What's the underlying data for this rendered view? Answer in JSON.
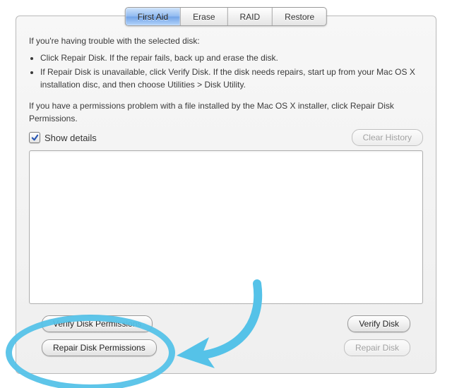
{
  "tabs": {
    "items": [
      {
        "label": "First Aid",
        "selected": true
      },
      {
        "label": "Erase",
        "selected": false
      },
      {
        "label": "RAID",
        "selected": false
      },
      {
        "label": "Restore",
        "selected": false
      }
    ]
  },
  "intro": {
    "line1": "If you're having trouble with the selected disk:",
    "bullet1": "Click Repair Disk. If the repair fails, back up and erase the disk.",
    "bullet2": "If Repair Disk is unavailable, click Verify Disk. If the disk needs repairs, start up from your Mac OS X installation disc, and then choose Utilities > Disk Utility.",
    "line2": "If you have a permissions problem with a file installed by the Mac OS X installer, click Repair Disk Permissions."
  },
  "details": {
    "show_label": "Show details",
    "show_checked": true,
    "clear_label": "Clear History"
  },
  "buttons": {
    "verify_perm": "Verify Disk Permissions",
    "repair_perm": "Repair Disk Permissions",
    "verify_disk": "Verify Disk",
    "repair_disk": "Repair Disk"
  },
  "annotation": {
    "color": "#55c2e8"
  }
}
